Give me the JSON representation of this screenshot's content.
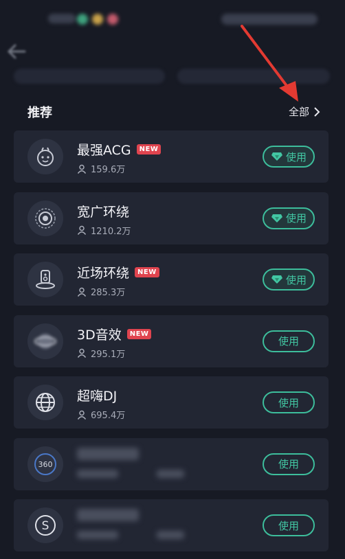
{
  "section": {
    "title": "推荐",
    "see_all": "全部"
  },
  "effects": [
    {
      "name": "最强ACG",
      "users": "159.6万",
      "is_new": true,
      "vip": true,
      "icon": "mascot-face-icon",
      "button": "使用"
    },
    {
      "name": "宽广环绕",
      "users": "1210.2万",
      "is_new": false,
      "vip": true,
      "icon": "surround-rings-icon",
      "button": "使用"
    },
    {
      "name": "近场环绕",
      "users": "285.3万",
      "is_new": true,
      "vip": true,
      "icon": "speaker-stage-icon",
      "button": "使用"
    },
    {
      "name": "3D音效",
      "users": "295.1万",
      "is_new": true,
      "vip": false,
      "icon": "orbit-sphere-icon",
      "button": "使用"
    },
    {
      "name": "超嗨DJ",
      "users": "695.4万",
      "is_new": false,
      "vip": false,
      "icon": "globe-icon",
      "button": "使用"
    },
    {
      "name": "",
      "users": "",
      "is_new": false,
      "vip": false,
      "icon": "360-icon",
      "button": "使用",
      "obscured": true
    },
    {
      "name": "",
      "users": "",
      "is_new": false,
      "vip": false,
      "icon": "s-coin-icon",
      "button": "使用",
      "obscured": true
    }
  ],
  "badge_text": "NEW",
  "colors": {
    "background": "#171a24",
    "card": "#222633",
    "accent": "#3dbe9c",
    "badge": "#e0444f",
    "annotation_arrow": "#e33a32"
  }
}
